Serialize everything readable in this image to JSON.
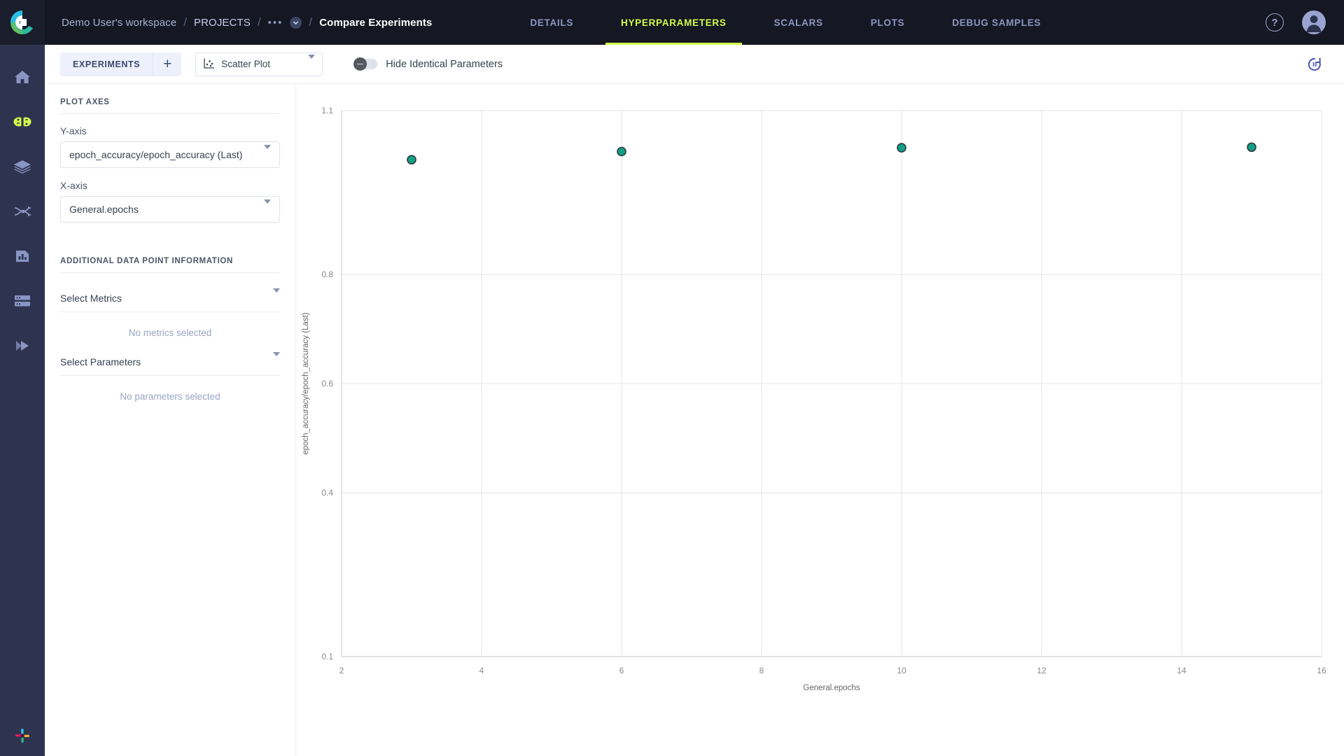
{
  "app": {
    "logo": "clearml-logo",
    "breadcrumb": {
      "workspace": "Demo User's workspace",
      "projects": "PROJECTS",
      "ellipsis": "•••",
      "current": "Compare Experiments",
      "separator": "/"
    },
    "tabs": [
      {
        "label": "DETAILS",
        "active": false
      },
      {
        "label": "HYPERPARAMETERS",
        "active": true
      },
      {
        "label": "SCALARS",
        "active": false
      },
      {
        "label": "PLOTS",
        "active": false
      },
      {
        "label": "DEBUG SAMPLES",
        "active": false
      }
    ],
    "help_icon": "help-circle-icon",
    "avatar_icon": "user-avatar-icon",
    "accent_color": "#d3fc49",
    "topbar_color": "#151723"
  },
  "sidebar": {
    "items": [
      {
        "name": "home",
        "label": "Home",
        "active": false
      },
      {
        "name": "projects",
        "label": "Projects",
        "active": true
      },
      {
        "name": "datasets",
        "label": "Datasets",
        "active": false
      },
      {
        "name": "pipelines",
        "label": "Pipelines",
        "active": false
      },
      {
        "name": "reports",
        "label": "Reports",
        "active": false
      },
      {
        "name": "workers",
        "label": "Workers and Queues",
        "active": false
      },
      {
        "name": "applications",
        "label": "Applications",
        "active": false
      }
    ],
    "bottom": {
      "name": "slack",
      "label": "Slack"
    }
  },
  "toolbar": {
    "experiments_label": "EXPERIMENTS",
    "add_label": "+",
    "plot_type": "Scatter Plot",
    "plot_type_icon": "scatter-plot-icon",
    "hide_identical_label": "Hide Identical Parameters",
    "hide_identical_on": false,
    "refresh_icon": "auto-refresh-pause-icon"
  },
  "panel": {
    "plot_axes_title": "PLOT AXES",
    "y_axis_label": "Y-axis",
    "y_axis_value": "epoch_accuracy/epoch_accuracy (Last)",
    "x_axis_label": "X-axis",
    "x_axis_value": "General.epochs",
    "additional_title": "ADDITIONAL DATA POINT INFORMATION",
    "select_metrics_label": "Select Metrics",
    "no_metrics_text": "No metrics selected",
    "select_parameters_label": "Select Parameters",
    "no_parameters_text": "No parameters selected"
  },
  "chart_data": {
    "type": "scatter",
    "title": "",
    "xlabel": "General.epochs",
    "ylabel": "epoch_accuracy/epoch_accuracy (Last)",
    "xlim": [
      2,
      16
    ],
    "ylim": [
      0.1,
      1.1
    ],
    "xticks": [
      2,
      4,
      6,
      8,
      10,
      12,
      14,
      16
    ],
    "yticks": [
      0.1,
      0.4,
      0.6,
      0.8,
      1.1
    ],
    "grid": true,
    "legend": "none",
    "marker_color": "#11a085",
    "marker_edge_color": "#2f3a42",
    "points": [
      {
        "x": 3,
        "y": 1.01
      },
      {
        "x": 6,
        "y": 1.025
      },
      {
        "x": 10,
        "y": 1.032
      },
      {
        "x": 15,
        "y": 1.033
      }
    ]
  }
}
